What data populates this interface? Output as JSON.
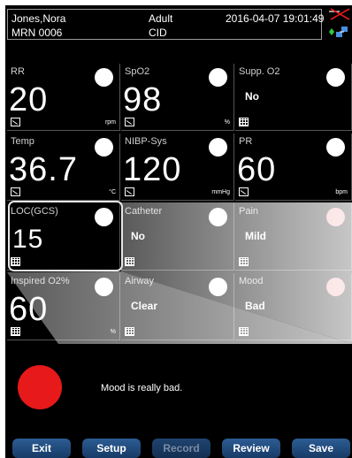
{
  "header": {
    "patient_name": "Jones,Nora",
    "mrn": "MRN 0006",
    "patient_category": "Adult",
    "cid": "CID",
    "datetime": "2016-04-07 19:01:49"
  },
  "tiles": [
    {
      "name": "RR",
      "value": "20",
      "unit": "rpm"
    },
    {
      "name": "SpO2",
      "value": "98",
      "unit": "%"
    },
    {
      "name": "Supp. O2",
      "value": "No",
      "unit": ""
    },
    {
      "name": "Temp",
      "value": "36.7",
      "unit": "°C"
    },
    {
      "name": "NIBP-Sys",
      "value": "120",
      "unit": "mmHg"
    },
    {
      "name": "PR",
      "value": "60",
      "unit": "bpm"
    },
    {
      "name": "LOC(GCS)",
      "value": "15",
      "unit": ""
    },
    {
      "name": "Catheter",
      "value": "No",
      "unit": ""
    },
    {
      "name": "Pain",
      "value": "Mild",
      "unit": ""
    },
    {
      "name": "Inspired O2%",
      "value": "60",
      "unit": "%"
    },
    {
      "name": "Airway",
      "value": "Clear",
      "unit": ""
    },
    {
      "name": "Mood",
      "value": "Bad",
      "unit": ""
    }
  ],
  "message": {
    "text": "Mood is really bad.",
    "indicator_color": "#e8191a"
  },
  "buttons": {
    "exit": "Exit",
    "setup": "Setup",
    "record": "Record",
    "review": "Review",
    "save": "Save"
  },
  "colors": {
    "background": "#000000",
    "button": "#1f4a7c",
    "alarm_pink": "#f3a3a3"
  }
}
